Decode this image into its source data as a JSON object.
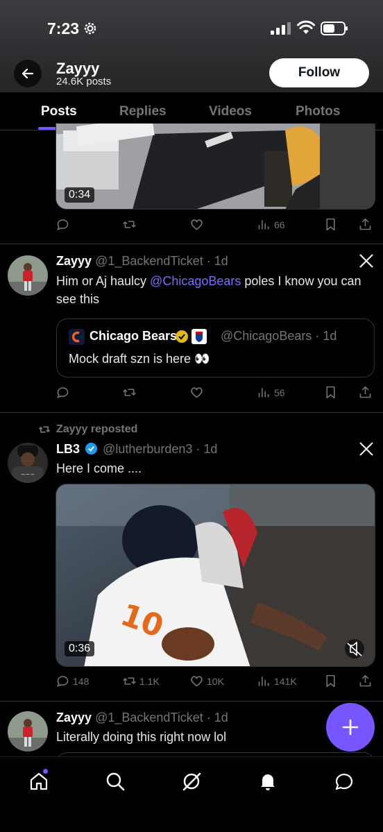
{
  "status_bar": {
    "time": "7:23"
  },
  "header": {
    "name": "Zayyy",
    "posts": "24.6K posts",
    "follow_label": "Follow"
  },
  "tabs": [
    {
      "label": "Posts"
    },
    {
      "label": "Replies"
    },
    {
      "label": "Videos"
    },
    {
      "label": "Photos"
    }
  ],
  "post1": {
    "duration": "0:34",
    "views": "66"
  },
  "post2": {
    "name": "Zayyy",
    "handle": "@1_BackendTicket · 1d",
    "text_before": "Him or Aj haulcy ",
    "mention": "@ChicagoBears",
    "text_after": " poles I know you can see this",
    "quote": {
      "name": "Chicago Bears",
      "handle": "@ChicagoBears · 1d",
      "text": "Mock draft szn is here 👀"
    },
    "views": "56"
  },
  "post3": {
    "repost_label": "Zayyy reposted",
    "name": "LB3",
    "handle": "@lutherburden3 · 1d",
    "text": "Here I come ....",
    "duration": "0:36",
    "replies": "148",
    "reposts": "1.1K",
    "likes": "10K",
    "views": "141K"
  },
  "post4": {
    "name": "Zayyy",
    "handle": "@1_BackendTicket · 1d",
    "text": "Literally doing this right now lol"
  },
  "colors": {
    "accent": "#7856ff",
    "mention": "#7b6cff",
    "muted": "#71767b",
    "divider": "#2f3336"
  }
}
